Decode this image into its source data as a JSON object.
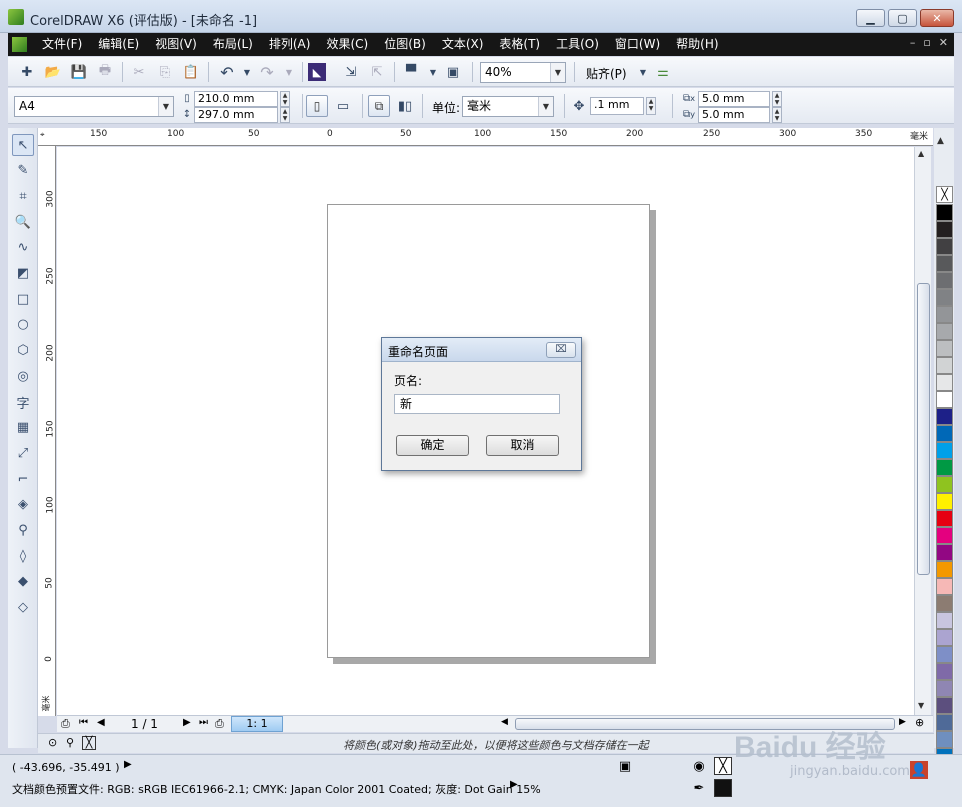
{
  "window": {
    "title": "CorelDRAW X6 (评估版) - [未命名 -1]",
    "minimize": "▁",
    "maximize": "▢",
    "close": "✕"
  },
  "menu": {
    "items": [
      "文件(F)",
      "编辑(E)",
      "视图(V)",
      "布局(L)",
      "排列(A)",
      "效果(C)",
      "位图(B)",
      "文本(X)",
      "表格(T)",
      "工具(O)",
      "窗口(W)",
      "帮助(H)"
    ],
    "controls": [
      "–",
      "▫",
      "✕"
    ]
  },
  "toolbar": {
    "zoom": "40%",
    "snap": "贴齐(P)"
  },
  "property_bar": {
    "page_size": "A4",
    "width": "210.0 mm",
    "height": "297.0 mm",
    "units_label": "单位:",
    "units": "毫米",
    "nudge": ".1 mm",
    "dup_x": "5.0 mm",
    "dup_y": "5.0 mm",
    "dup_x_sub": "x",
    "dup_y_sub": "y"
  },
  "ruler": {
    "h_labels": [
      "150",
      "100",
      "50",
      "0",
      "50",
      "100",
      "150",
      "200",
      "250",
      "300",
      "350"
    ],
    "h_unit": "毫米",
    "v_labels": [
      "300",
      "250",
      "200",
      "150",
      "100",
      "50",
      "0"
    ],
    "v_unit": "毫米"
  },
  "tools": [
    {
      "name": "pick-tool",
      "glyph": "↖"
    },
    {
      "name": "shape-tool",
      "glyph": "✎"
    },
    {
      "name": "crop-tool",
      "glyph": "⌗"
    },
    {
      "name": "zoom-tool",
      "glyph": "🔍"
    },
    {
      "name": "freehand-tool",
      "glyph": "∿"
    },
    {
      "name": "smart-fill-tool",
      "glyph": "◩"
    },
    {
      "name": "rectangle-tool",
      "glyph": "□"
    },
    {
      "name": "ellipse-tool",
      "glyph": "○"
    },
    {
      "name": "polygon-tool",
      "glyph": "⬡"
    },
    {
      "name": "basic-shapes-tool",
      "glyph": "◎"
    },
    {
      "name": "text-tool",
      "glyph": "字"
    },
    {
      "name": "table-tool",
      "glyph": "▦"
    },
    {
      "name": "dimension-tool",
      "glyph": "⤢"
    },
    {
      "name": "connector-tool",
      "glyph": "⌐"
    },
    {
      "name": "blend-tool",
      "glyph": "◈"
    },
    {
      "name": "eyedropper-tool",
      "glyph": "⚲"
    },
    {
      "name": "outline-tool",
      "glyph": "◊"
    },
    {
      "name": "fill-tool",
      "glyph": "◆"
    },
    {
      "name": "interactive-fill-tool",
      "glyph": "◇"
    }
  ],
  "palette": [
    "#000000",
    "#231f20",
    "#414042",
    "#58595b",
    "#6d6e71",
    "#808285",
    "#939598",
    "#a7a9ac",
    "#bcbec0",
    "#d1d3d4",
    "#e6e7e8",
    "#ffffff",
    "#1d2088",
    "#0068b7",
    "#00a0e9",
    "#009944",
    "#8fc31f",
    "#fff100",
    "#e60012",
    "#e4007f",
    "#920783",
    "#f39800",
    "#f6b8b6",
    "#8c7c72",
    "#c8c5df",
    "#aba4d0",
    "#7e8fc7",
    "#7f6aa8",
    "#8f86b3",
    "#5c4f7e",
    "#4f6a98",
    "#6f8fbf",
    "#0071bc"
  ],
  "doc": {
    "page_counter": "1 / 1",
    "page_tab": "1: 1"
  },
  "hint": "将颜色(或对象)拖动至此处，以便将这些颜色与文档存储在一起",
  "status": {
    "coords": "( -43.696, -35.491 )",
    "profile": "文档颜色预置文件: RGB: sRGB IEC61966-2.1; CMYK: Japan Color 2001 Coated; 灰度: Dot Gain 15%"
  },
  "watermark": {
    "text": "Baidu 经验",
    "sub": "jingyan.baidu.com"
  },
  "dialog": {
    "title": "重命名页面",
    "close": "⌧",
    "field_label": "页名:",
    "field_value": "新",
    "ok": "确定",
    "cancel": "取消"
  }
}
